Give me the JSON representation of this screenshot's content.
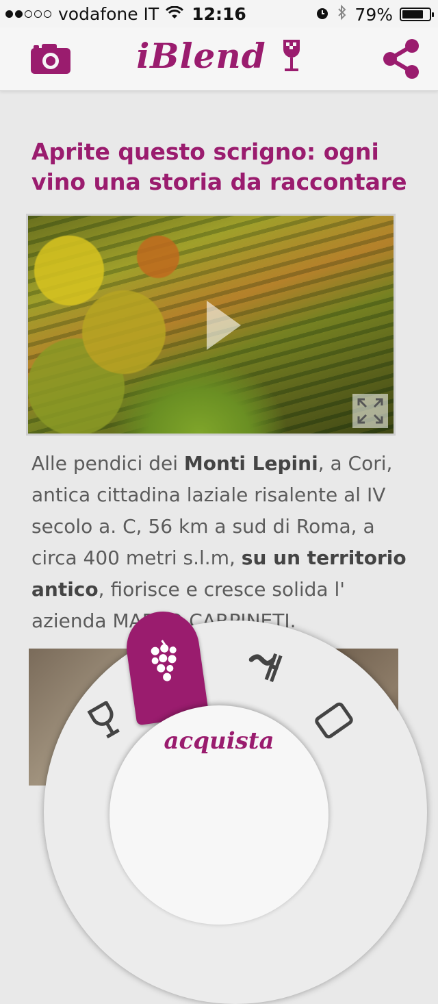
{
  "status_bar": {
    "carrier": "vodafone IT",
    "time": "12:16",
    "battery": "79%",
    "battery_level": 0.79,
    "signal_bars": 2
  },
  "nav": {
    "logo": "iBlend",
    "camera_icon": "camera-icon",
    "share_icon": "share-icon",
    "wine_icon": "wine-glass-icon"
  },
  "article": {
    "title": "Aprite questo scrigno: ogni vino una storia da raccontare",
    "body": {
      "t1": "Alle pendici dei ",
      "b1": "Monti Lepini",
      "t2": ", a Cori, antica cittadina laziale risalente al IV secolo a. C, 56 km a sud di Roma, a circa 400 metri s.l.m, ",
      "b2": "su un territorio antico",
      "t3": ", fiorisce e cresce solida l' azienda MARCO CARPINETI."
    }
  },
  "radial_menu": {
    "center_label": "acquista",
    "items": [
      "grapes-icon",
      "vineyard-icon",
      "wine-glass-icon",
      "tablet-icon"
    ]
  },
  "colors": {
    "accent": "#9a1c6e",
    "background": "#e9e9e9"
  }
}
